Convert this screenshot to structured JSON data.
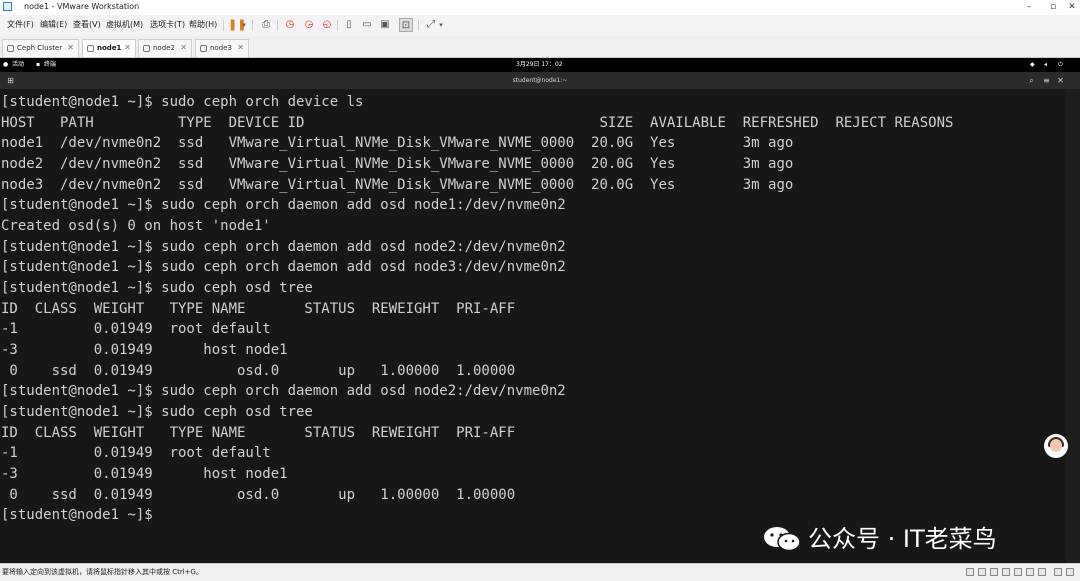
{
  "window": {
    "title": "node1 - VMware Workstation"
  },
  "menu": [
    "文件(F)",
    "编辑(E)",
    "查看(V)",
    "虚拟机(M)",
    "选项卡(T)",
    "帮助(H)"
  ],
  "toolbar": [
    {
      "name": "pause-icon",
      "glyph": "❚❚"
    },
    {
      "name": "dropdown-arrow-icon",
      "glyph": "▾"
    },
    {
      "name": "send-keys-icon",
      "glyph": "⎙"
    },
    {
      "name": "snapshot-icon",
      "glyph": "◷"
    },
    {
      "name": "revert-snapshot-icon",
      "glyph": "◶"
    },
    {
      "name": "snapshot-manager-icon",
      "glyph": "◵"
    },
    {
      "name": "sidebar-view-icon",
      "glyph": "▯"
    },
    {
      "name": "thumbnail-view-icon",
      "glyph": "▭"
    },
    {
      "name": "fullscreen-view-icon",
      "glyph": "▣"
    },
    {
      "name": "console-view-icon",
      "glyph": "⊡"
    },
    {
      "name": "stretch-view-icon",
      "glyph": "⤢"
    },
    {
      "name": "stretch-dropdown-icon",
      "glyph": "▾"
    }
  ],
  "tabs": [
    {
      "label": "Ceph Cluster",
      "active": false
    },
    {
      "label": "node1",
      "active": true
    },
    {
      "label": "node2",
      "active": false
    },
    {
      "label": "node3",
      "active": false
    }
  ],
  "gnome": {
    "activities": "活动",
    "app": "终端",
    "clock": "3月29日  17：02"
  },
  "terminal": {
    "header_title": "student@node1:~",
    "lines": [
      "[student@node1 ~]$ sudo ceph orch device ls",
      "HOST   PATH          TYPE  DEVICE ID                                   SIZE  AVAILABLE  REFRESHED  REJECT REASONS",
      "node1  /dev/nvme0n2  ssd   VMware_Virtual_NVMe_Disk_VMware_NVME_0000  20.0G  Yes        3m ago",
      "node2  /dev/nvme0n2  ssd   VMware_Virtual_NVMe_Disk_VMware_NVME_0000  20.0G  Yes        3m ago",
      "node3  /dev/nvme0n2  ssd   VMware_Virtual_NVMe_Disk_VMware_NVME_0000  20.0G  Yes        3m ago",
      "[student@node1 ~]$ sudo ceph orch daemon add osd node1:/dev/nvme0n2",
      "Created osd(s) 0 on host 'node1'",
      "[student@node1 ~]$ sudo ceph orch daemon add osd node2:/dev/nvme0n2",
      "[student@node1 ~]$ sudo ceph orch daemon add osd node3:/dev/nvme0n2",
      "[student@node1 ~]$ sudo ceph osd tree",
      "ID  CLASS  WEIGHT   TYPE NAME       STATUS  REWEIGHT  PRI-AFF",
      "-1         0.01949  root default",
      "-3         0.01949      host node1",
      " 0    ssd  0.01949          osd.0       up   1.00000  1.00000",
      "[student@node1 ~]$ sudo ceph orch daemon add osd node2:/dev/nvme0n2",
      "[student@node1 ~]$ sudo ceph osd tree",
      "ID  CLASS  WEIGHT   TYPE NAME       STATUS  REWEIGHT  PRI-AFF",
      "-1         0.01949  root default",
      "-3         0.01949      host node1",
      " 0    ssd  0.01949          osd.0       up   1.00000  1.00000",
      "[student@node1 ~]$"
    ]
  },
  "watermark": "公众号 · IT老菜鸟",
  "status": {
    "text": "要将输入定向到该虚拟机，请将鼠标指针移入其中或按 Ctrl+G。"
  },
  "colors": {
    "terminal_bg": "#171717",
    "terminal_fg": "#d0d0d0",
    "pause_accent": "#e07a16"
  }
}
